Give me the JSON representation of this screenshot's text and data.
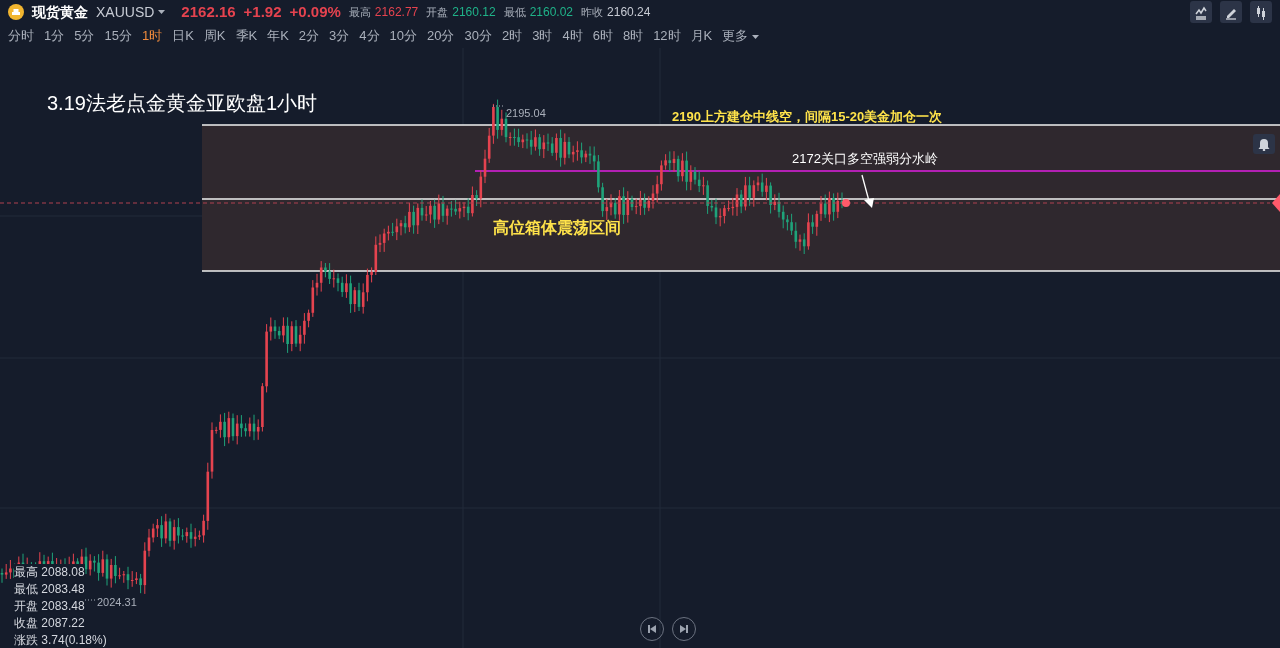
{
  "header": {
    "symbol_name": "现货黄金",
    "symbol_code": "XAUUSD",
    "price": "2162.16",
    "change": "+1.92",
    "change_pct": "+0.09%",
    "stats": [
      {
        "label": "最高",
        "value": "2162.77",
        "color": "#e5434f"
      },
      {
        "label": "开盘",
        "value": "2160.12",
        "color": "#1fb389"
      },
      {
        "label": "最低",
        "value": "2160.02",
        "color": "#1fb389"
      },
      {
        "label": "昨收",
        "value": "2160.24",
        "color": "#c7cbd4"
      }
    ]
  },
  "timeframes": [
    {
      "label": "分时",
      "selected": false
    },
    {
      "label": "1分",
      "selected": false
    },
    {
      "label": "5分",
      "selected": false
    },
    {
      "label": "15分",
      "selected": false
    },
    {
      "label": "1时",
      "selected": true
    },
    {
      "label": "日K",
      "selected": false
    },
    {
      "label": "周K",
      "selected": false
    },
    {
      "label": "季K",
      "selected": false
    },
    {
      "label": "年K",
      "selected": false
    },
    {
      "label": "2分",
      "selected": false
    },
    {
      "label": "3分",
      "selected": false
    },
    {
      "label": "4分",
      "selected": false
    },
    {
      "label": "10分",
      "selected": false
    },
    {
      "label": "20分",
      "selected": false
    },
    {
      "label": "30分",
      "selected": false
    },
    {
      "label": "2时",
      "selected": false
    },
    {
      "label": "3时",
      "selected": false
    },
    {
      "label": "4时",
      "selected": false
    },
    {
      "label": "6时",
      "selected": false
    },
    {
      "label": "8时",
      "selected": false
    },
    {
      "label": "12时",
      "selected": false
    },
    {
      "label": "月K",
      "selected": false
    },
    {
      "label": "更多",
      "selected": false
    }
  ],
  "chart": {
    "title": "3.19法老点金黄金亚欧盘1小时",
    "top_note": "2190上方建仓中线空，间隔15-20美金加仓一次",
    "mid_note": "2172关口多空强弱分水岭",
    "range_label": "高位箱体震荡区间",
    "high_label": "2195.04",
    "low_label": "2024.31",
    "ohlc": [
      {
        "label": "最高",
        "value": "2088.08"
      },
      {
        "label": "最低",
        "value": "2083.48"
      },
      {
        "label": "开盘",
        "value": "2083.48"
      },
      {
        "label": "收盘",
        "value": "2087.22"
      },
      {
        "label": "涨跌",
        "value": "3.74(0.18%)"
      }
    ]
  }
}
